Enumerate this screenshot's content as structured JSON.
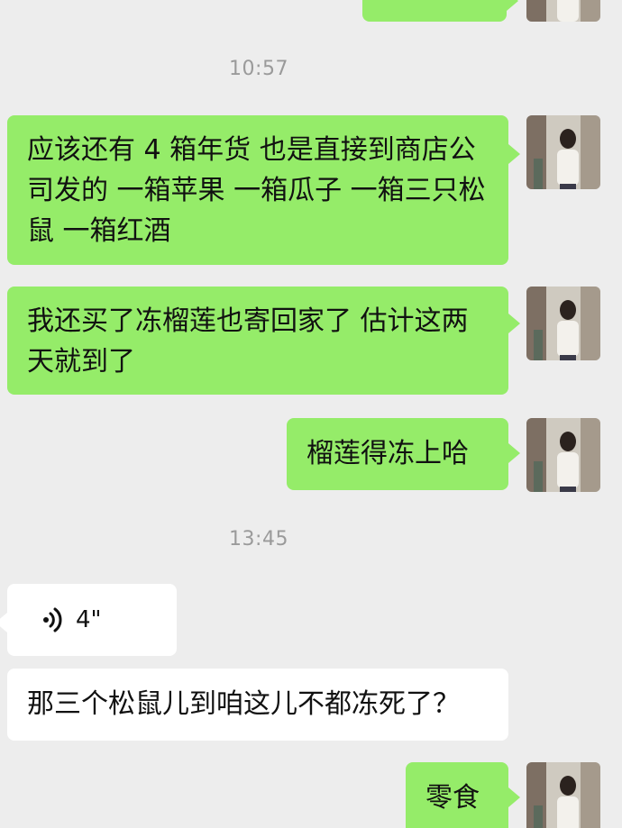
{
  "timestamps": [
    "10:57",
    "13:45"
  ],
  "messages": {
    "m1": "应该还有 4 箱年货 也是直接到商店公司发的 一箱苹果 一箱瓜子 一箱三只松鼠 一箱红酒",
    "m2": "我还买了冻榴莲也寄回家了 估计这两天就到了",
    "m3": "榴莲得冻上哈",
    "voice_duration": "4\"",
    "m5": "那三个松鼠儿到咱这儿不都冻死了？",
    "m6": "零食"
  },
  "colors": {
    "background": "#ededed",
    "my_bubble": "#95ec69",
    "their_bubble": "#ffffff",
    "timestamp": "#9a9a9a"
  },
  "icons": [
    "voice-icon",
    "avatar"
  ]
}
